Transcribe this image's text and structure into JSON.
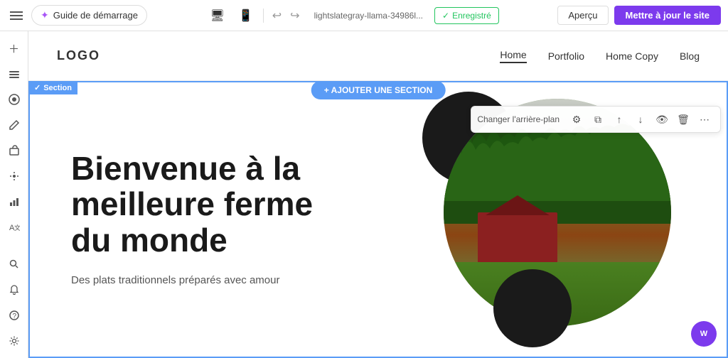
{
  "topbar": {
    "guide_label": "Guide de démarrage",
    "site_name": "lightslategray-llama-34986l...",
    "saved_label": "Enregistré",
    "preview_label": "Aperçu",
    "publish_label": "Mettre à jour le site"
  },
  "sidebar": {
    "icons": [
      {
        "name": "add-icon",
        "symbol": "+"
      },
      {
        "name": "layers-icon",
        "symbol": "⊞"
      },
      {
        "name": "theme-icon",
        "symbol": "◉"
      },
      {
        "name": "pencil-icon",
        "symbol": "✎"
      },
      {
        "name": "store-icon",
        "symbol": "⊡"
      },
      {
        "name": "animations-icon",
        "symbol": "✦"
      },
      {
        "name": "analytics-icon",
        "symbol": "▦"
      },
      {
        "name": "translate-icon",
        "symbol": "⟨A⟩"
      }
    ],
    "bottom_icons": [
      {
        "name": "search-icon",
        "symbol": "⌕"
      },
      {
        "name": "notification-icon",
        "symbol": "⚠"
      },
      {
        "name": "help-icon",
        "symbol": "?"
      },
      {
        "name": "settings-icon",
        "symbol": "⚙"
      }
    ]
  },
  "website": {
    "logo": "LOGO",
    "nav_links": [
      {
        "label": "Home",
        "active": true
      },
      {
        "label": "Portfolio",
        "active": false
      },
      {
        "label": "Home Copy",
        "active": false,
        "selected": false
      },
      {
        "label": "Blog",
        "active": false
      }
    ],
    "hero": {
      "title": "Bienvenue à la meilleure ferme du monde",
      "subtitle": "Des plats traditionnels préparés avec amour"
    }
  },
  "section_ui": {
    "section_label": "✓ Section",
    "add_section_label": "+ AJOUTER UNE SECTION",
    "toolbar_bg_label": "Changer l'arrière-plan"
  },
  "wix_logo": "W"
}
